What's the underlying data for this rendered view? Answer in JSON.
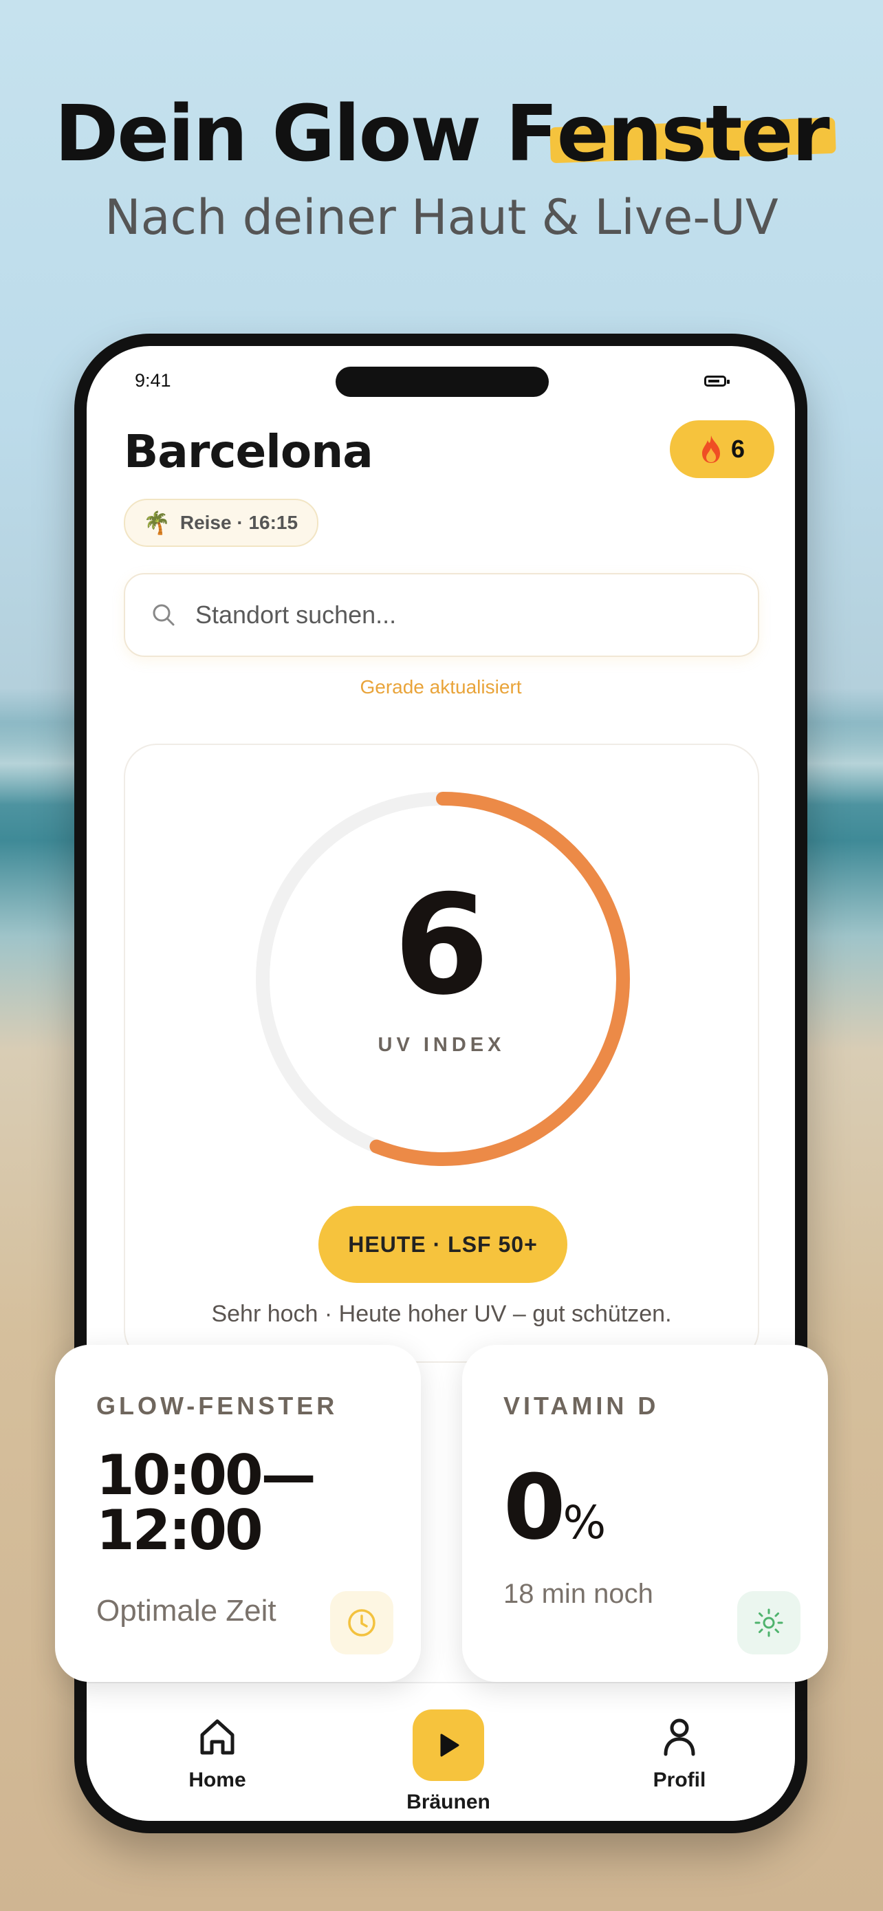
{
  "promo": {
    "headline_part1": "Dein Glow F",
    "headline_highlight": "enster",
    "subline": "Nach deiner Haut & Live-UV"
  },
  "status_bar": {
    "time": "9:41"
  },
  "header": {
    "city": "Barcelona",
    "streak_count": "6",
    "trip_chip": "Reise · 16:15"
  },
  "search": {
    "placeholder": "Standort suchen...",
    "value": ""
  },
  "updated_text": "Gerade aktualisiert",
  "uv": {
    "value": "6",
    "label": "UV INDEX",
    "gauge_fraction": 0.56,
    "spf_pill": "HEUTE · LSF 50+",
    "description": "Sehr hoch · Heute hoher UV – gut schützen."
  },
  "glow_window": {
    "title": "GLOW-FENSTER",
    "time_range": "10:00—\n12:00",
    "subtitle": "Optimale Zeit"
  },
  "vitamin_d": {
    "title": "VITAMIN D",
    "percent": "0",
    "unit": "%",
    "remaining": "18 min noch"
  },
  "tabbar": {
    "home": "Home",
    "center": "Bräunen",
    "profile": "Profil"
  },
  "colors": {
    "accent_yellow": "#f6c33d",
    "gauge_orange": "#ec8a47",
    "gauge_track": "#f1f1f1",
    "updated_orange": "#e9a43a"
  }
}
